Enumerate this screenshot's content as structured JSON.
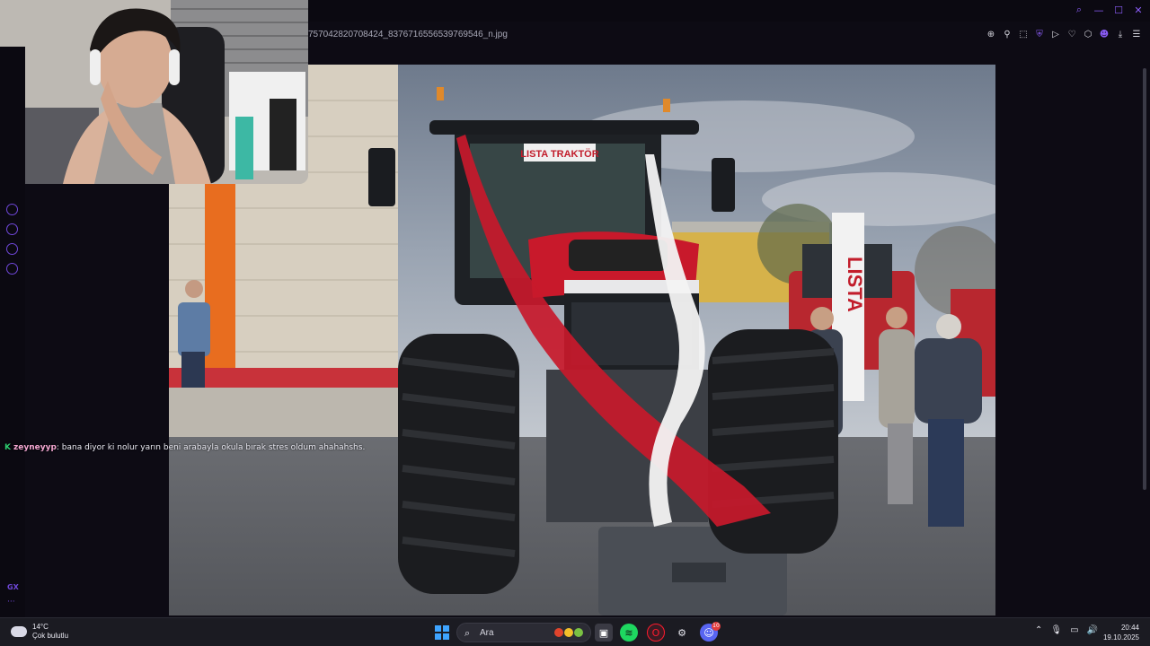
{
  "window": {
    "filename": "757042820708424_8376716556539769546_n.jpg"
  },
  "icons": {
    "window_controls": [
      "search-icon",
      "minimize-icon",
      "maximize-icon",
      "close-icon"
    ],
    "toolbar": [
      "zoom-in-icon",
      "pin-icon",
      "crop-icon",
      "shield-icon",
      "play-icon",
      "heart-icon",
      "extensions-icon",
      "profile-icon",
      "download-icon",
      "menu-icon"
    ],
    "sidebar": [
      "player-icon",
      "history-icon",
      "extensions-icon",
      "settings-icon"
    ]
  },
  "sidebar": {
    "gx_label": "GX",
    "more_label": "···"
  },
  "chat": {
    "username": "zeyneyyp",
    "message": ": bana diyor ki nolur yarın beni arabayla okula bırak stres oldum ahahahshs."
  },
  "photo": {
    "tractor_brand_label": "LISTA TRAKTÖR",
    "banner_label": "LISTA"
  },
  "taskbar": {
    "weather_temp": "14°C",
    "weather_desc": "Çok bulutlu",
    "search_placeholder": "Ara",
    "time": "20:44",
    "date": "19.10.2025",
    "notification_count": "10"
  },
  "colors": {
    "accent": "#8a5cf6",
    "tractor_red": "#c8192b",
    "chat_badge": "#2ecc71"
  }
}
